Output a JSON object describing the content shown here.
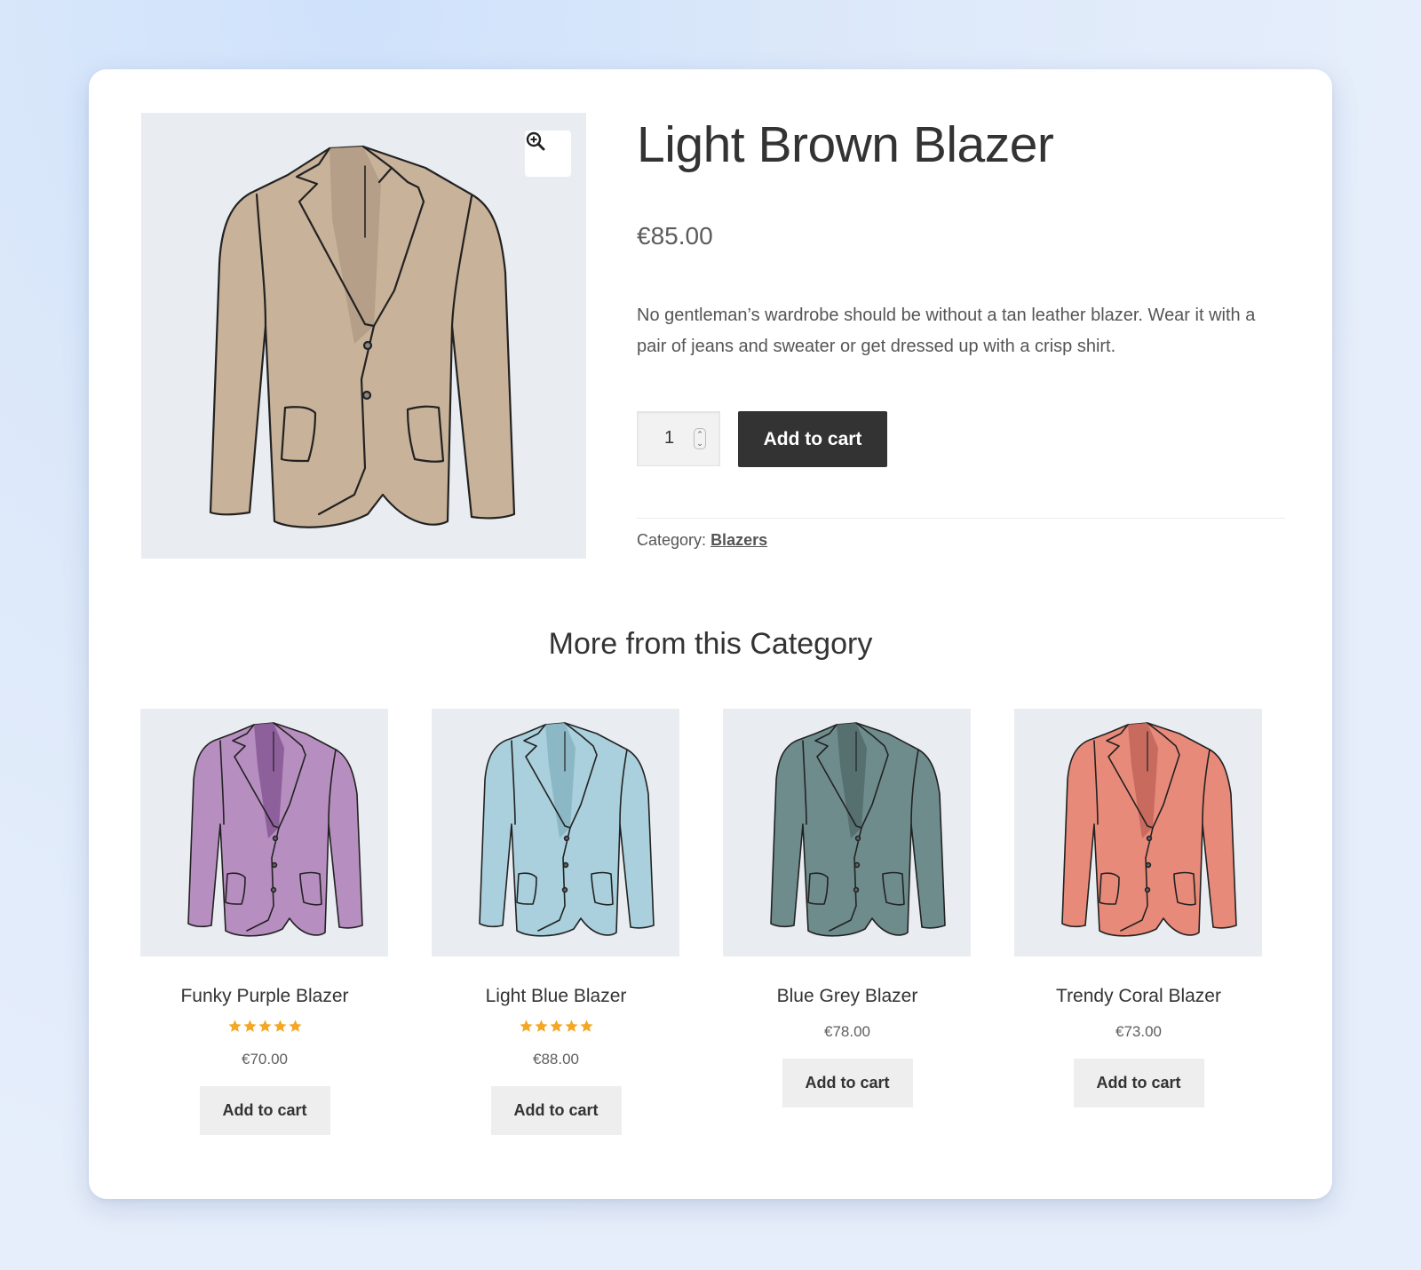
{
  "product": {
    "title": "Light Brown Blazer",
    "price": "€85.00",
    "description": "No gentleman’s wardrobe should be without a tan leather blazer. Wear it with a pair of jeans and sweater or get dressed up with a crisp shirt.",
    "quantity": "1",
    "add_to_cart_label": "Add to cart",
    "category_label": "Category:",
    "category_link": "Blazers",
    "jacket_color": "#c9b29a",
    "jacket_inner_color": "#b59f88",
    "zoom_icon": "zoom-in-icon"
  },
  "related": {
    "heading": "More from this Category",
    "items": [
      {
        "name": "Funky Purple Blazer",
        "price": "€70.00",
        "rating": 5,
        "add_label": "Add to cart",
        "color": "#b78ec0",
        "inner": "#8d5f9b"
      },
      {
        "name": "Light Blue Blazer",
        "price": "€88.00",
        "rating": 5,
        "add_label": "Add to cart",
        "color": "#a9d0dc",
        "inner": "#8cb8c6"
      },
      {
        "name": "Blue Grey Blazer",
        "price": "€78.00",
        "rating": 0,
        "add_label": "Add to cart",
        "color": "#6f8c8d",
        "inner": "#56706f"
      },
      {
        "name": "Trendy Coral Blazer",
        "price": "€73.00",
        "rating": 0,
        "add_label": "Add to cart",
        "color": "#e88a7a",
        "inner": "#c86a5e"
      }
    ]
  },
  "colors": {
    "star": "#f5a623",
    "button_dark": "#333333",
    "button_light": "#eeeeee"
  }
}
